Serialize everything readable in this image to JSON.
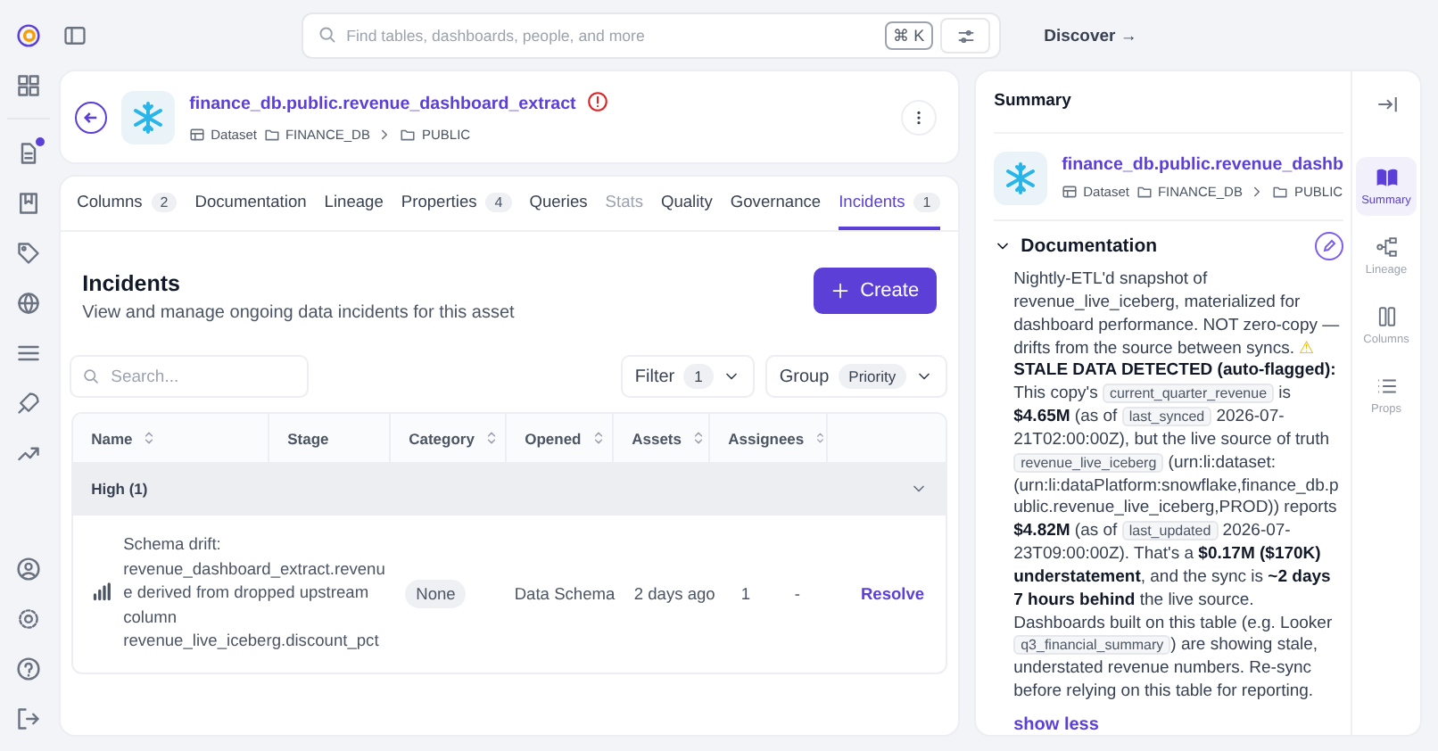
{
  "search": {
    "placeholder": "Find tables, dashboards, people, and more",
    "shortcut": "⌘ K"
  },
  "discover": "Discover →",
  "asset": {
    "title": "finance_db.public.revenue_dashboard_extract",
    "warning": true,
    "type": "Dataset",
    "path": [
      "FINANCE_DB",
      "PUBLIC"
    ]
  },
  "tabs": [
    {
      "label": "Columns",
      "count": "2",
      "selected": false,
      "disabled": false
    },
    {
      "label": "Documentation",
      "selected": false,
      "disabled": false
    },
    {
      "label": "Lineage",
      "selected": false,
      "disabled": false
    },
    {
      "label": "Properties",
      "count": "4",
      "selected": false,
      "disabled": false
    },
    {
      "label": "Queries",
      "selected": false,
      "disabled": false
    },
    {
      "label": "Stats",
      "selected": false,
      "disabled": true
    },
    {
      "label": "Quality",
      "selected": false,
      "disabled": false
    },
    {
      "label": "Governance",
      "selected": false,
      "disabled": false
    },
    {
      "label": "Incidents",
      "count": "1",
      "selected": true,
      "disabled": false
    }
  ],
  "incidents": {
    "title": "Incidents",
    "subtitle": "View and manage ongoing data incidents for this asset",
    "create_button": "Create",
    "search": {
      "placeholder": "Search..."
    },
    "filter": {
      "label": "Filter",
      "count": "1"
    },
    "group": {
      "label": "Group",
      "value": "Priority"
    },
    "columns": [
      {
        "label": "Name",
        "sortable": true
      },
      {
        "label": "Stage",
        "sortable": false
      },
      {
        "label": "Category",
        "sortable": true
      },
      {
        "label": "Opened",
        "sortable": true
      },
      {
        "label": "Assets",
        "sortable": true
      },
      {
        "label": "Assignees",
        "sortable": true
      }
    ],
    "groups": [
      {
        "label": "High (1)",
        "expanded": true,
        "rows": [
          {
            "name": "Schema drift: revenue_dashboard_extract.revenue derived from dropped upstream column revenue_live_iceberg.discount_pct",
            "stage": "None",
            "category": "Data Schema",
            "opened": "2 days ago",
            "assets": "1",
            "assignees": "-",
            "action": "Resolve"
          }
        ]
      }
    ]
  },
  "summary": {
    "title": "Summary",
    "asset_title": "finance_db.public.revenue_dashb",
    "type": "Dataset",
    "path": [
      "FINANCE_DB",
      "PUBLIC"
    ],
    "documentation": {
      "title": "Documentation",
      "expanded": true,
      "toggle": "show less",
      "segments": [
        {
          "kind": "text",
          "text": "Nightly-ETL'd snapshot of revenue_live_iceberg, materialized for dashboard performance. NOT zero-copy — drifts from the source between syncs. "
        },
        {
          "kind": "warning",
          "text": "⚠"
        },
        {
          "kind": "text",
          "text": " **STALE DATA DETECTED (auto-flagged):** This copy's "
        },
        {
          "kind": "code",
          "text": "current_quarter_revenue"
        },
        {
          "kind": "text",
          "text": " is **$4.65M** (as of "
        },
        {
          "kind": "code",
          "text": "last_synced"
        },
        {
          "kind": "text",
          "text": " 2026-07-21T02:00:00Z), but the live source of truth "
        },
        {
          "kind": "code",
          "text": "revenue_live_iceberg"
        },
        {
          "kind": "text",
          "text": " (urn:li:dataset:(urn:li:dataPlatform:snowflake,finance_db.public.revenue_live_iceberg,PROD)) reports **$4.82M** (as of "
        },
        {
          "kind": "code",
          "text": "last_updated"
        },
        {
          "kind": "text",
          "text": " 2026-07-23T09:00:00Z). That's a **$0.17M ($170K) understatement**, and the sync is **~2 days 7 hours behind** the live source. Dashboards built on this table (e.g. Looker "
        },
        {
          "kind": "code",
          "text": "q3_financial_summary"
        },
        {
          "kind": "text",
          "text": ") are showing stale, understated revenue numbers. Re-sync before relying on this table for reporting."
        }
      ]
    }
  },
  "rail": [
    {
      "label": "Summary",
      "selected": true
    },
    {
      "label": "Lineage",
      "selected": false
    },
    {
      "label": "Columns",
      "selected": false
    },
    {
      "label": "Props",
      "selected": false
    }
  ]
}
